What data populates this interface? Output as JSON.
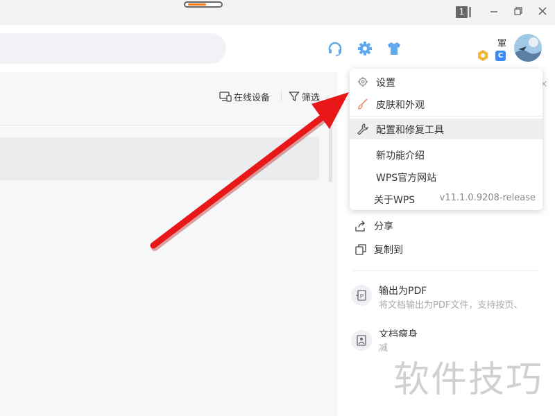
{
  "titlebar": {
    "progress_fraction": 0.6,
    "window_count": "1"
  },
  "header": {
    "user_name": "軍"
  },
  "toolbar": {
    "online_devices": "在线设备",
    "filter": "筛选"
  },
  "menu": {
    "items": [
      {
        "label": "设置",
        "icon": "gear-icon"
      },
      {
        "label": "皮肤和外观",
        "icon": "brush-icon"
      },
      {
        "label": "配置和修复工具",
        "icon": "wrench-icon"
      },
      {
        "label": "新功能介绍"
      },
      {
        "label": "WPS官方网站"
      },
      {
        "label": "关于WPS"
      }
    ],
    "version": "v11.1.0.9208-release"
  },
  "panel": {
    "share": "分享",
    "copy_to": "复制到",
    "export_pdf_title": "输出为PDF",
    "export_pdf_desc": "将文档输出为PDF文件，支持按页、",
    "doc_info_title": "文档瘦身",
    "doc_info_desc": "减"
  },
  "watermark": "软件技巧",
  "colors": {
    "accent_orange": "#f07a1a",
    "arrow_red": "#e81818",
    "icon_blue": "#3d8bf2"
  }
}
